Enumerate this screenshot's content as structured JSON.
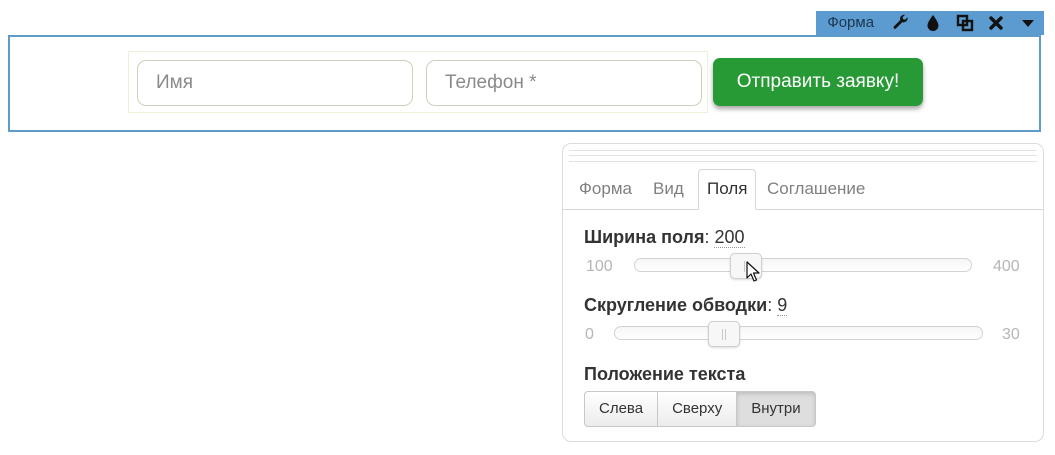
{
  "toolbar": {
    "title": "Форма",
    "icons": [
      "wrench-icon",
      "droplet-icon",
      "copy-icon",
      "close-icon",
      "caret-down-icon"
    ],
    "background": "#5b9bcf"
  },
  "form": {
    "name_placeholder": "Имя",
    "phone_placeholder": "Телефон *",
    "submit_label": "Отправить заявку!",
    "submit_color": "#279a36",
    "border_color": "#5d9bc8"
  },
  "panel": {
    "tabs": [
      {
        "label": "Форма"
      },
      {
        "label": "Вид"
      },
      {
        "label": "Поля",
        "active": true
      },
      {
        "label": "Соглашение"
      }
    ],
    "field_width": {
      "label": "Ширина поля",
      "value": "200",
      "min": "100",
      "max": "400"
    },
    "border_radius": {
      "label": "Скругление обводки",
      "value": "9",
      "min": "0",
      "max": "30"
    },
    "text_position": {
      "label": "Положение текста",
      "options": [
        "Слева",
        "Сверху",
        "Внутри"
      ],
      "selected": "Внутри"
    }
  }
}
